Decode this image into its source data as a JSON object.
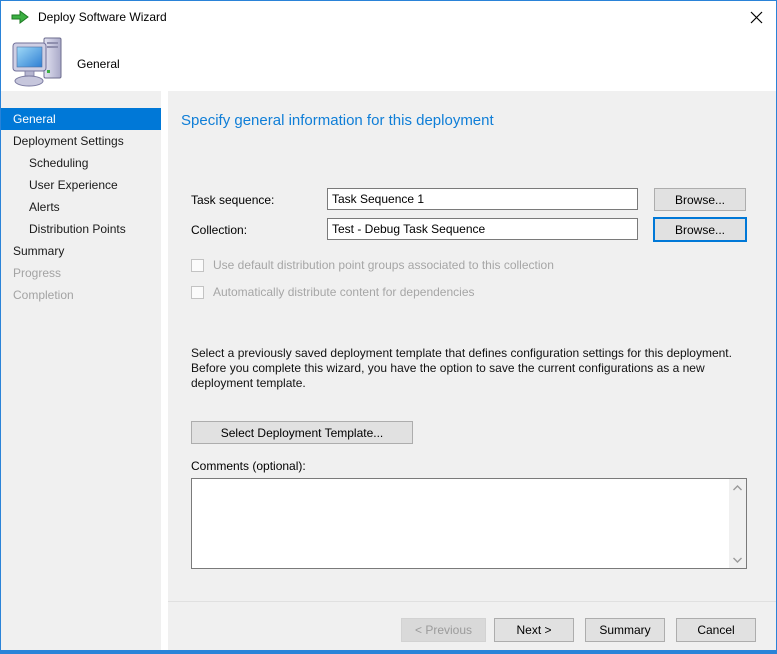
{
  "window": {
    "title": "Deploy Software Wizard",
    "colors": {
      "accent_blue": "#0078d7",
      "window_border": "#2a83d8",
      "heading_blue": "#0f7ed7",
      "panel_gray": "#f0f0f0",
      "selected_nav_bg": "#0078d7"
    },
    "icons": {
      "title": "green-arrow-icon",
      "header": "computer-icon",
      "close": "close-icon",
      "scroll_up": "chevron-up-icon",
      "scroll_down": "chevron-down-icon"
    }
  },
  "header": {
    "page_label": "General"
  },
  "sidebar": {
    "items": [
      {
        "label": "General",
        "state": "selected",
        "level": 0
      },
      {
        "label": "Deployment Settings",
        "state": "enabled",
        "level": 0
      },
      {
        "label": "Scheduling",
        "state": "enabled",
        "level": 1
      },
      {
        "label": "User Experience",
        "state": "enabled",
        "level": 1
      },
      {
        "label": "Alerts",
        "state": "enabled",
        "level": 1
      },
      {
        "label": "Distribution Points",
        "state": "enabled",
        "level": 1
      },
      {
        "label": "Summary",
        "state": "enabled",
        "level": 0
      },
      {
        "label": "Progress",
        "state": "disabled",
        "level": 0
      },
      {
        "label": "Completion",
        "state": "disabled",
        "level": 0
      }
    ]
  },
  "main": {
    "heading": "Specify general information for this deployment",
    "fields": {
      "task_sequence": {
        "label": "Task sequence:",
        "value": "Task Sequence 1",
        "browse_label": "Browse..."
      },
      "collection": {
        "label": "Collection:",
        "value": "Test - Debug Task Sequence",
        "browse_label": "Browse..."
      }
    },
    "checkboxes": [
      {
        "label": "Use default distribution point groups associated to this collection",
        "checked": false,
        "disabled": true
      },
      {
        "label": "Automatically distribute content for dependencies",
        "checked": false,
        "disabled": true
      }
    ],
    "template_paragraph": "Select a previously saved deployment template that defines configuration settings for this deployment. Before you complete this wizard, you have the option to save the current configurations as a new deployment template.",
    "select_template_button": "Select Deployment Template...",
    "comments": {
      "label": "Comments (optional):",
      "value": ""
    }
  },
  "footer": {
    "buttons": [
      {
        "label": "< Previous",
        "disabled": true
      },
      {
        "label": "Next >",
        "disabled": false
      },
      {
        "label": "Summary",
        "disabled": false
      },
      {
        "label": "Cancel",
        "disabled": false
      }
    ]
  }
}
